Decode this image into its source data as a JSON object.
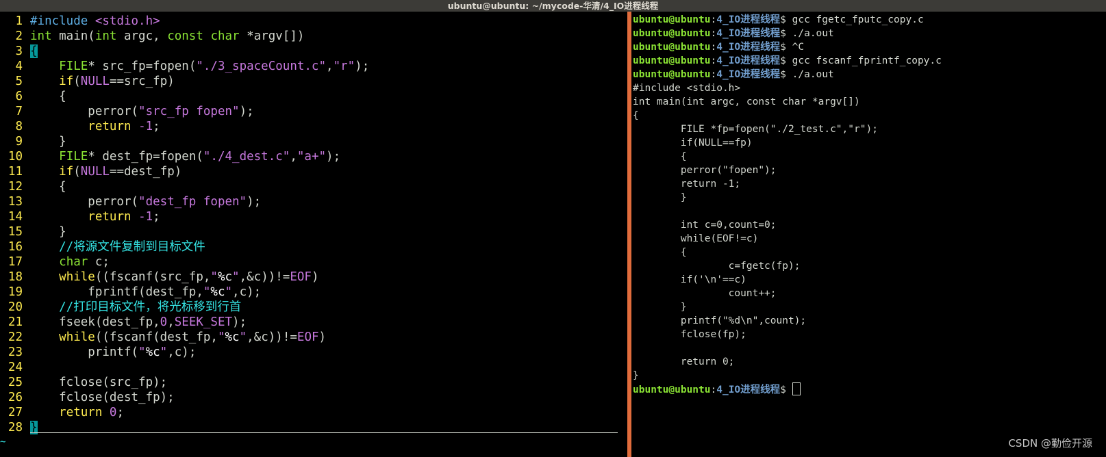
{
  "window": {
    "title": "ubuntu@ubuntu: ~/mycode-华清/4_IO进程线程"
  },
  "vim": {
    "lines": [
      {
        "n": "1",
        "segs": [
          [
            "#include",
            "k-pre"
          ],
          [
            " ",
            ""
          ],
          [
            "<stdio.h>",
            "k-inc"
          ]
        ]
      },
      {
        "n": "2",
        "segs": [
          [
            "int",
            "k-type"
          ],
          [
            " main(",
            ""
          ],
          [
            "int",
            "k-type"
          ],
          [
            " argc, ",
            ""
          ],
          [
            "const",
            "k-type"
          ],
          [
            " ",
            ""
          ],
          [
            "char",
            "k-type"
          ],
          [
            " *argv[])",
            ""
          ]
        ]
      },
      {
        "n": "3",
        "segs": [
          [
            "{",
            "cursor-ch"
          ]
        ]
      },
      {
        "n": "4",
        "segs": [
          [
            "    ",
            ""
          ],
          [
            "FILE",
            "k-type"
          ],
          [
            "* src_fp=fopen(",
            ""
          ],
          [
            "\"./3_spaceCount.c\"",
            "k-str"
          ],
          [
            ",",
            ""
          ],
          [
            "\"r\"",
            "k-str"
          ],
          [
            ");",
            ""
          ]
        ]
      },
      {
        "n": "5",
        "segs": [
          [
            "    ",
            ""
          ],
          [
            "if",
            "k-stmt"
          ],
          [
            "(",
            ""
          ],
          [
            "NULL",
            "k-const"
          ],
          [
            "==src_fp)",
            ""
          ]
        ]
      },
      {
        "n": "6",
        "segs": [
          [
            "    {",
            ""
          ]
        ]
      },
      {
        "n": "7",
        "segs": [
          [
            "        perror(",
            ""
          ],
          [
            "\"src_fp fopen\"",
            "k-str"
          ],
          [
            ");",
            ""
          ]
        ]
      },
      {
        "n": "8",
        "segs": [
          [
            "        ",
            ""
          ],
          [
            "return",
            "k-stmt"
          ],
          [
            " ",
            ""
          ],
          [
            "-1",
            "k-const"
          ],
          [
            ";",
            ""
          ]
        ]
      },
      {
        "n": "9",
        "segs": [
          [
            "    }",
            ""
          ]
        ]
      },
      {
        "n": "10",
        "segs": [
          [
            "    ",
            ""
          ],
          [
            "FILE",
            "k-type"
          ],
          [
            "* dest_fp=fopen(",
            ""
          ],
          [
            "\"./4_dest.c\"",
            "k-str"
          ],
          [
            ",",
            ""
          ],
          [
            "\"a+\"",
            "k-str"
          ],
          [
            ");",
            ""
          ]
        ]
      },
      {
        "n": "11",
        "segs": [
          [
            "    ",
            ""
          ],
          [
            "if",
            "k-stmt"
          ],
          [
            "(",
            ""
          ],
          [
            "NULL",
            "k-const"
          ],
          [
            "==dest_fp)",
            ""
          ]
        ]
      },
      {
        "n": "12",
        "segs": [
          [
            "    {",
            ""
          ]
        ]
      },
      {
        "n": "13",
        "segs": [
          [
            "        perror(",
            ""
          ],
          [
            "\"dest_fp fopen\"",
            "k-str"
          ],
          [
            ");",
            ""
          ]
        ]
      },
      {
        "n": "14",
        "segs": [
          [
            "        ",
            ""
          ],
          [
            "return",
            "k-stmt"
          ],
          [
            " ",
            ""
          ],
          [
            "-1",
            "k-const"
          ],
          [
            ";",
            ""
          ]
        ]
      },
      {
        "n": "15",
        "segs": [
          [
            "    }",
            ""
          ]
        ]
      },
      {
        "n": "16",
        "segs": [
          [
            "    ",
            ""
          ],
          [
            "//将源文件复制到目标文件",
            "k-cmt"
          ]
        ]
      },
      {
        "n": "17",
        "segs": [
          [
            "    ",
            ""
          ],
          [
            "char",
            "k-type"
          ],
          [
            " c;",
            ""
          ]
        ]
      },
      {
        "n": "18",
        "segs": [
          [
            "    ",
            ""
          ],
          [
            "while",
            "k-stmt"
          ],
          [
            "((fscanf(src_fp,",
            ""
          ],
          [
            "\"",
            "k-str"
          ],
          [
            "%c",
            "k-fmt"
          ],
          [
            "\"",
            "k-str"
          ],
          [
            ",&c))!=",
            ""
          ],
          [
            "EOF",
            "k-const"
          ],
          [
            ")",
            ""
          ]
        ]
      },
      {
        "n": "19",
        "segs": [
          [
            "        fprintf(dest_fp,",
            ""
          ],
          [
            "\"",
            "k-str"
          ],
          [
            "%c",
            "k-fmt"
          ],
          [
            "\"",
            "k-str"
          ],
          [
            ",c);",
            ""
          ]
        ]
      },
      {
        "n": "20",
        "segs": [
          [
            "    ",
            ""
          ],
          [
            "//打印目标文件，将光标移到行首",
            "k-cmt"
          ]
        ]
      },
      {
        "n": "21",
        "segs": [
          [
            "    fseek(dest_fp,",
            ""
          ],
          [
            "0",
            "k-const"
          ],
          [
            ",",
            ""
          ],
          [
            "SEEK_SET",
            "k-const"
          ],
          [
            ");",
            ""
          ]
        ]
      },
      {
        "n": "22",
        "segs": [
          [
            "    ",
            ""
          ],
          [
            "while",
            "k-stmt"
          ],
          [
            "((fscanf(dest_fp,",
            ""
          ],
          [
            "\"",
            "k-str"
          ],
          [
            "%c",
            "k-fmt"
          ],
          [
            "\"",
            "k-str"
          ],
          [
            ",&c))!=",
            ""
          ],
          [
            "EOF",
            "k-const"
          ],
          [
            ")",
            ""
          ]
        ]
      },
      {
        "n": "23",
        "segs": [
          [
            "        printf(",
            ""
          ],
          [
            "\"",
            "k-str"
          ],
          [
            "%c",
            "k-fmt"
          ],
          [
            "\"",
            "k-str"
          ],
          [
            ",c);",
            ""
          ]
        ]
      },
      {
        "n": "24",
        "segs": [
          [
            "",
            ""
          ]
        ]
      },
      {
        "n": "25",
        "segs": [
          [
            "    fclose(src_fp);",
            ""
          ]
        ]
      },
      {
        "n": "26",
        "segs": [
          [
            "    fclose(dest_fp);",
            ""
          ]
        ]
      },
      {
        "n": "27",
        "segs": [
          [
            "    ",
            ""
          ],
          [
            "return",
            "k-stmt"
          ],
          [
            " ",
            ""
          ],
          [
            "0",
            "k-const"
          ],
          [
            ";",
            ""
          ]
        ]
      },
      {
        "n": "28",
        "segs": [
          [
            "}",
            "cursor-ch"
          ]
        ]
      }
    ],
    "tilde": "~"
  },
  "terminal": {
    "prompt_user": "ubuntu@ubuntu",
    "prompt_colon": ":",
    "prompt_path": "4_IO进程线程",
    "prompt_suffix": "$ ",
    "lines": [
      {
        "prompt": true,
        "text": "gcc fgetc_fputc_copy.c"
      },
      {
        "prompt": true,
        "text": "./a.out"
      },
      {
        "prompt": true,
        "text": "^C"
      },
      {
        "prompt": true,
        "text": "gcc fscanf_fprintf_copy.c"
      },
      {
        "prompt": true,
        "text": "./a.out"
      },
      {
        "prompt": false,
        "text": "#include <stdio.h>"
      },
      {
        "prompt": false,
        "text": "int main(int argc, const char *argv[])"
      },
      {
        "prompt": false,
        "text": "{"
      },
      {
        "prompt": false,
        "text": "        FILE *fp=fopen(\"./2_test.c\",\"r\");"
      },
      {
        "prompt": false,
        "text": "        if(NULL==fp)"
      },
      {
        "prompt": false,
        "text": "        {"
      },
      {
        "prompt": false,
        "text": "        perror(\"fopen\");"
      },
      {
        "prompt": false,
        "text": "        return -1;"
      },
      {
        "prompt": false,
        "text": "        }"
      },
      {
        "prompt": false,
        "text": ""
      },
      {
        "prompt": false,
        "text": "        int c=0,count=0;"
      },
      {
        "prompt": false,
        "text": "        while(EOF!=c)"
      },
      {
        "prompt": false,
        "text": "        {"
      },
      {
        "prompt": false,
        "text": "                c=fgetc(fp);"
      },
      {
        "prompt": false,
        "text": "        if('\\n'==c)"
      },
      {
        "prompt": false,
        "text": "                count++;"
      },
      {
        "prompt": false,
        "text": "        }"
      },
      {
        "prompt": false,
        "text": "        printf(\"%d\\n\",count);"
      },
      {
        "prompt": false,
        "text": "        fclose(fp);"
      },
      {
        "prompt": false,
        "text": ""
      },
      {
        "prompt": false,
        "text": "        return 0;"
      },
      {
        "prompt": false,
        "text": "}"
      },
      {
        "prompt": true,
        "text": "",
        "cursor": true
      }
    ]
  },
  "watermark": "CSDN @勤俭开源"
}
